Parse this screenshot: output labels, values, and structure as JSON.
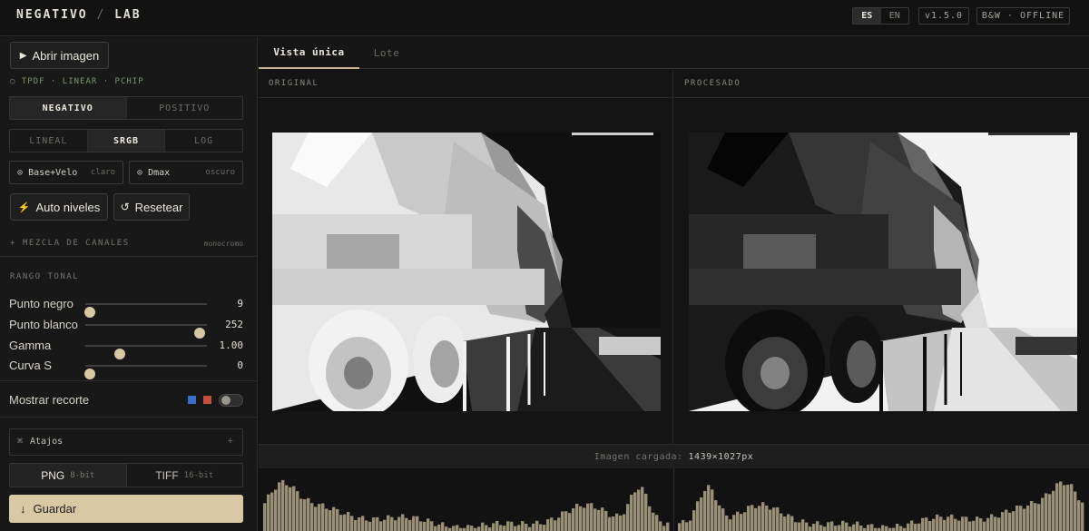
{
  "app": {
    "name": "NEGATIVO",
    "separator": "/",
    "suffix": "LAB"
  },
  "header": {
    "languages": [
      {
        "code": "ES",
        "active": true
      },
      {
        "code": "EN",
        "active": false
      }
    ],
    "version": "v1.5.0",
    "mode": "B&W · OFFLINE"
  },
  "sidebar": {
    "open_button": "Abrir imagen",
    "dither_info": "TPDF · LINEAR · PCHIP",
    "film_type": {
      "options": [
        "NEGATIVO",
        "POSITIVO"
      ],
      "selected": "NEGATIVO"
    },
    "curve_space": {
      "options": [
        "LINEAL",
        "SRGB",
        "LOG"
      ],
      "selected": "SRGB"
    },
    "pickers": [
      {
        "label": "Base+Velo",
        "hint": "claro"
      },
      {
        "label": "Dmax",
        "hint": "oscuro"
      }
    ],
    "auto_button": "Auto niveles",
    "reset_button": "Resetear",
    "channel_mix": {
      "label": "MEZCLA DE CANALES",
      "value": "monocromo"
    },
    "tonal_range": {
      "title": "RANGO TONAL",
      "sliders": [
        {
          "label": "Punto negro",
          "value": "9",
          "fraction": 0.035
        },
        {
          "label": "Punto blanco",
          "value": "252",
          "fraction": 0.94
        },
        {
          "label": "Gamma",
          "value": "1.00",
          "fraction": 0.28
        },
        {
          "label": "Curva S",
          "value": "0",
          "fraction": 0.04
        }
      ]
    },
    "show_clip": {
      "label": "Mostrar recorte",
      "enabled": false,
      "swatch_colors": [
        "#3a6fc4",
        "#c4503a"
      ]
    },
    "shortcuts": {
      "label": "Atajos",
      "expand": "+"
    },
    "formats": [
      {
        "name": "PNG",
        "depth": "8-bit",
        "active": true
      },
      {
        "name": "TIFF",
        "depth": "16-bit",
        "active": false
      }
    ],
    "save_button": "Guardar"
  },
  "tabs": [
    {
      "label": "Vista única",
      "active": true
    },
    {
      "label": "Lote",
      "active": false
    }
  ],
  "panes": {
    "original": "ORIGINAL",
    "processed": "PROCESADO"
  },
  "status": {
    "label": "Imagen cargada:",
    "value": "1439×1027px"
  },
  "colors": {
    "accent": "#d9c8a4",
    "background": "#141414",
    "histogram": "#b3a68a"
  }
}
